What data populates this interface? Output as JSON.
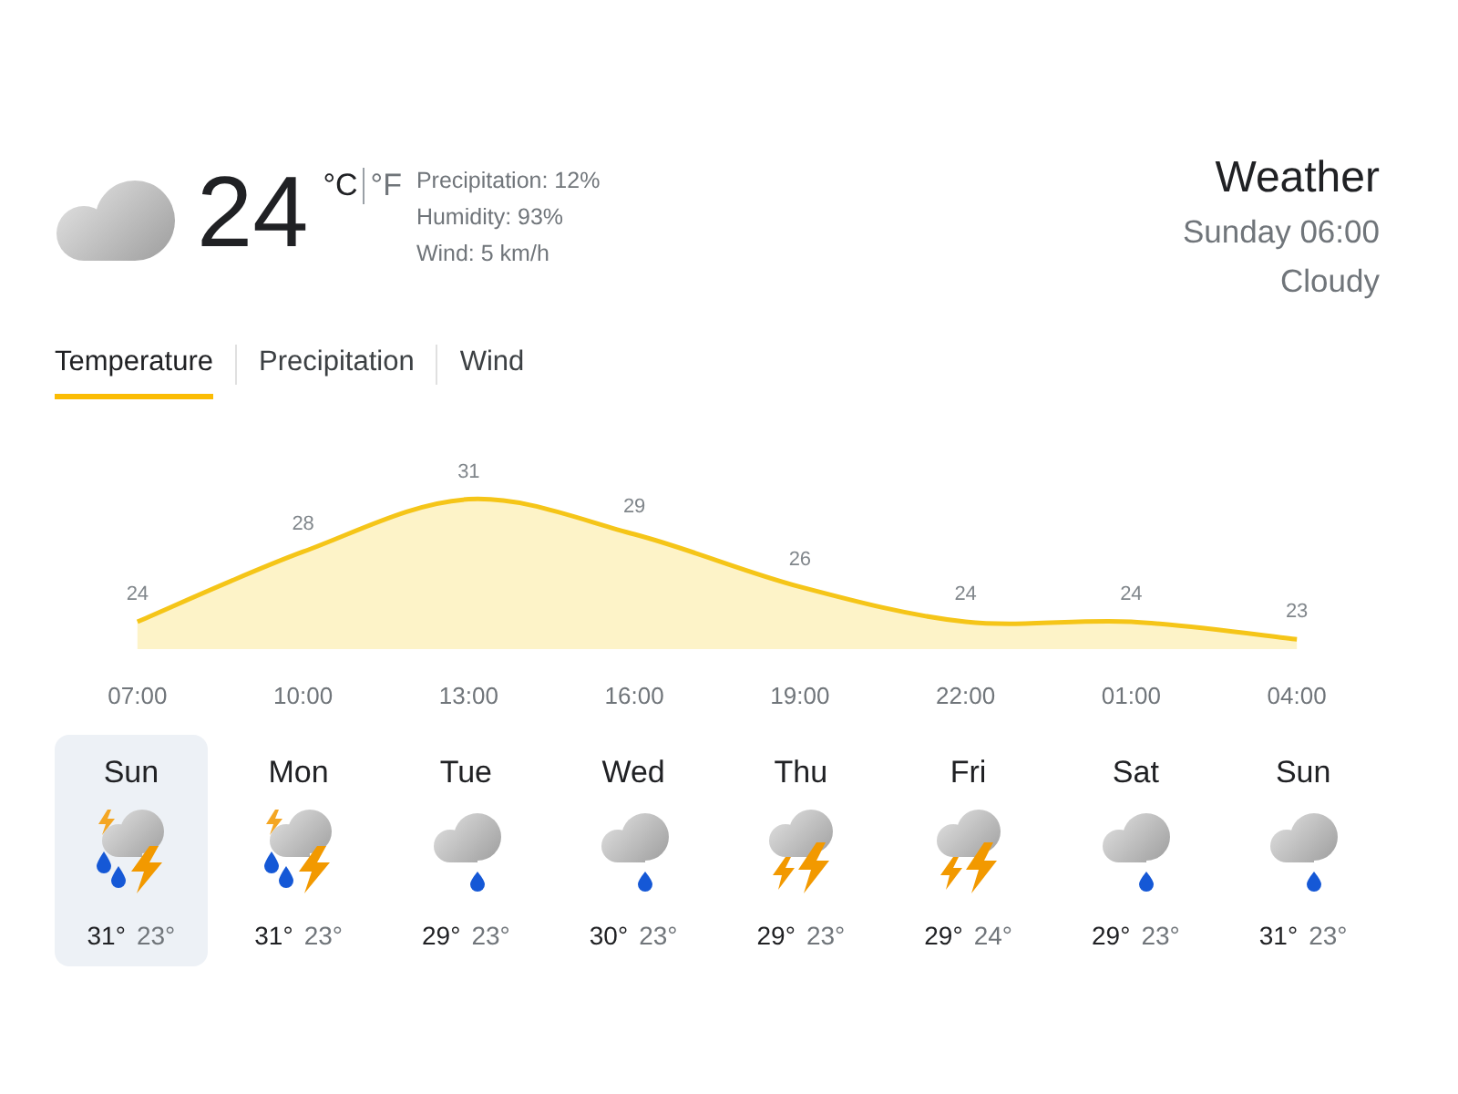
{
  "current": {
    "temperature": "24",
    "units": [
      {
        "label": "°C",
        "selected": true
      },
      {
        "label": "°F",
        "selected": false
      }
    ],
    "details": [
      "Precipitation: 12%",
      "Humidity: 93%",
      "Wind: 5 km/h"
    ]
  },
  "header": {
    "title": "Weather",
    "datetime": "Sunday 06:00",
    "condition": "Cloudy"
  },
  "tabs": [
    {
      "label": "Temperature",
      "selected": true
    },
    {
      "label": "Precipitation",
      "selected": false
    },
    {
      "label": "Wind",
      "selected": false
    }
  ],
  "hourly": {
    "chart_data": {
      "type": "area",
      "categories": [
        "07:00",
        "10:00",
        "13:00",
        "16:00",
        "19:00",
        "22:00",
        "01:00",
        "04:00"
      ],
      "values": [
        24,
        28,
        31,
        29,
        26,
        24,
        24,
        23
      ],
      "data_labels": true
    }
  },
  "days": [
    {
      "day": "Sun",
      "kind": "storm-showers",
      "high": "31°",
      "low": "23°",
      "selected": true
    },
    {
      "day": "Mon",
      "kind": "storm-showers",
      "high": "31°",
      "low": "23°",
      "selected": false
    },
    {
      "day": "Tue",
      "kind": "light-rain",
      "high": "29°",
      "low": "23°",
      "selected": false
    },
    {
      "day": "Wed",
      "kind": "light-rain",
      "high": "30°",
      "low": "23°",
      "selected": false
    },
    {
      "day": "Thu",
      "kind": "thunderstorms",
      "high": "29°",
      "low": "23°",
      "selected": false
    },
    {
      "day": "Fri",
      "kind": "thunderstorms",
      "high": "29°",
      "low": "24°",
      "selected": false
    },
    {
      "day": "Sat",
      "kind": "light-rain",
      "high": "29°",
      "low": "23°",
      "selected": false
    },
    {
      "day": "Sun",
      "kind": "light-rain",
      "high": "31°",
      "low": "23°",
      "selected": false
    }
  ]
}
